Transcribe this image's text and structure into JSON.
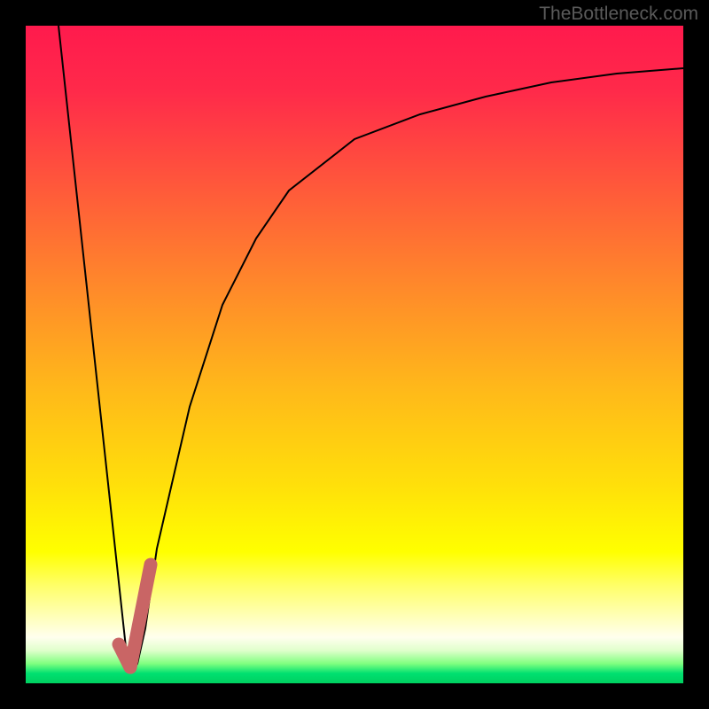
{
  "watermark": "TheBottleneck.com",
  "chart_data": {
    "type": "line",
    "title": "",
    "xlabel": "",
    "ylabel": "",
    "xlim": [
      0,
      100
    ],
    "ylim": [
      0,
      100
    ],
    "series": [
      {
        "name": "main-curve",
        "color": "#000000",
        "stroke_width": 2,
        "points": [
          {
            "x": 5,
            "y": 100
          },
          {
            "x": 15,
            "y": 5
          },
          {
            "x": 16,
            "y": 3
          },
          {
            "x": 17,
            "y": 5
          },
          {
            "x": 18,
            "y": 10
          },
          {
            "x": 20,
            "y": 20
          },
          {
            "x": 25,
            "y": 42
          },
          {
            "x": 30,
            "y": 58
          },
          {
            "x": 35,
            "y": 68
          },
          {
            "x": 40,
            "y": 75
          },
          {
            "x": 50,
            "y": 82
          },
          {
            "x": 60,
            "y": 86
          },
          {
            "x": 70,
            "y": 89
          },
          {
            "x": 80,
            "y": 91
          },
          {
            "x": 90,
            "y": 92.5
          },
          {
            "x": 100,
            "y": 93.5
          }
        ]
      },
      {
        "name": "highlight-segment",
        "color": "#c96565",
        "stroke_width": 14,
        "points": [
          {
            "x": 14,
            "y": 6
          },
          {
            "x": 16,
            "y": 3
          },
          {
            "x": 19,
            "y": 18
          }
        ]
      }
    ],
    "gradient_colors": {
      "top": "#ff1a4d",
      "middle": "#ffe00a",
      "bottom": "#00d060"
    }
  }
}
